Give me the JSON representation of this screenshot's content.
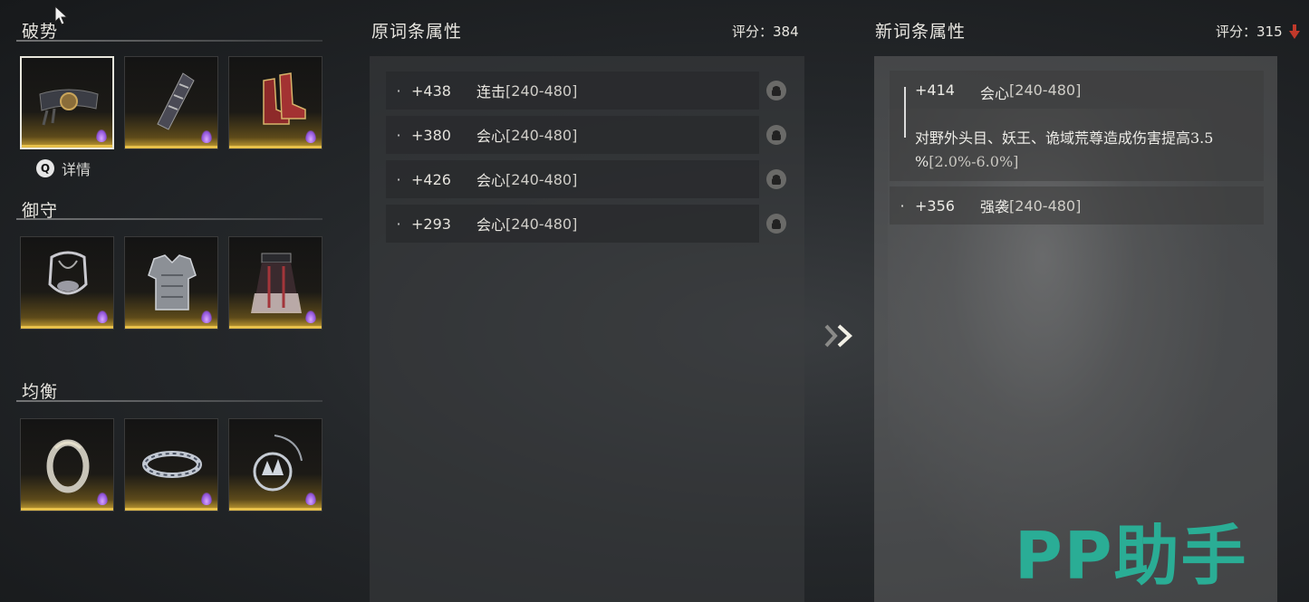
{
  "left": {
    "sections": [
      {
        "title": "破势"
      },
      {
        "title": "御守"
      },
      {
        "title": "均衡"
      }
    ],
    "detail_label": "详情"
  },
  "old_panel": {
    "title": "原词条属性",
    "score_label": "评分：",
    "score_value": "384",
    "rows": [
      {
        "value": "+438",
        "name": "连击",
        "range": "[240-480]"
      },
      {
        "value": "+380",
        "name": "会心",
        "range": "[240-480]"
      },
      {
        "value": "+426",
        "name": "会心",
        "range": "[240-480]"
      },
      {
        "value": "+293",
        "name": "会心",
        "range": "[240-480]"
      }
    ]
  },
  "new_panel": {
    "title": "新词条属性",
    "score_label": "评分：",
    "score_value": "315",
    "row1_value": "+414",
    "row1_name": "会心",
    "row1_range": "[240-480]",
    "row1_desc": "对野外头目、妖王、诡域荒尊造成伤害提高3.5",
    "row1_desc2": "%",
    "row1_desc_range": "[2.0%-6.0%]",
    "row2_value": "+356",
    "row2_name": "强袭",
    "row2_range": "[240-480]"
  },
  "watermark": "PP助手",
  "colors": {
    "gold": "#e7c04a",
    "score_down": "#c0392b",
    "watermark": "#29b39a",
    "rarity_flame": "#8c4fd8"
  }
}
